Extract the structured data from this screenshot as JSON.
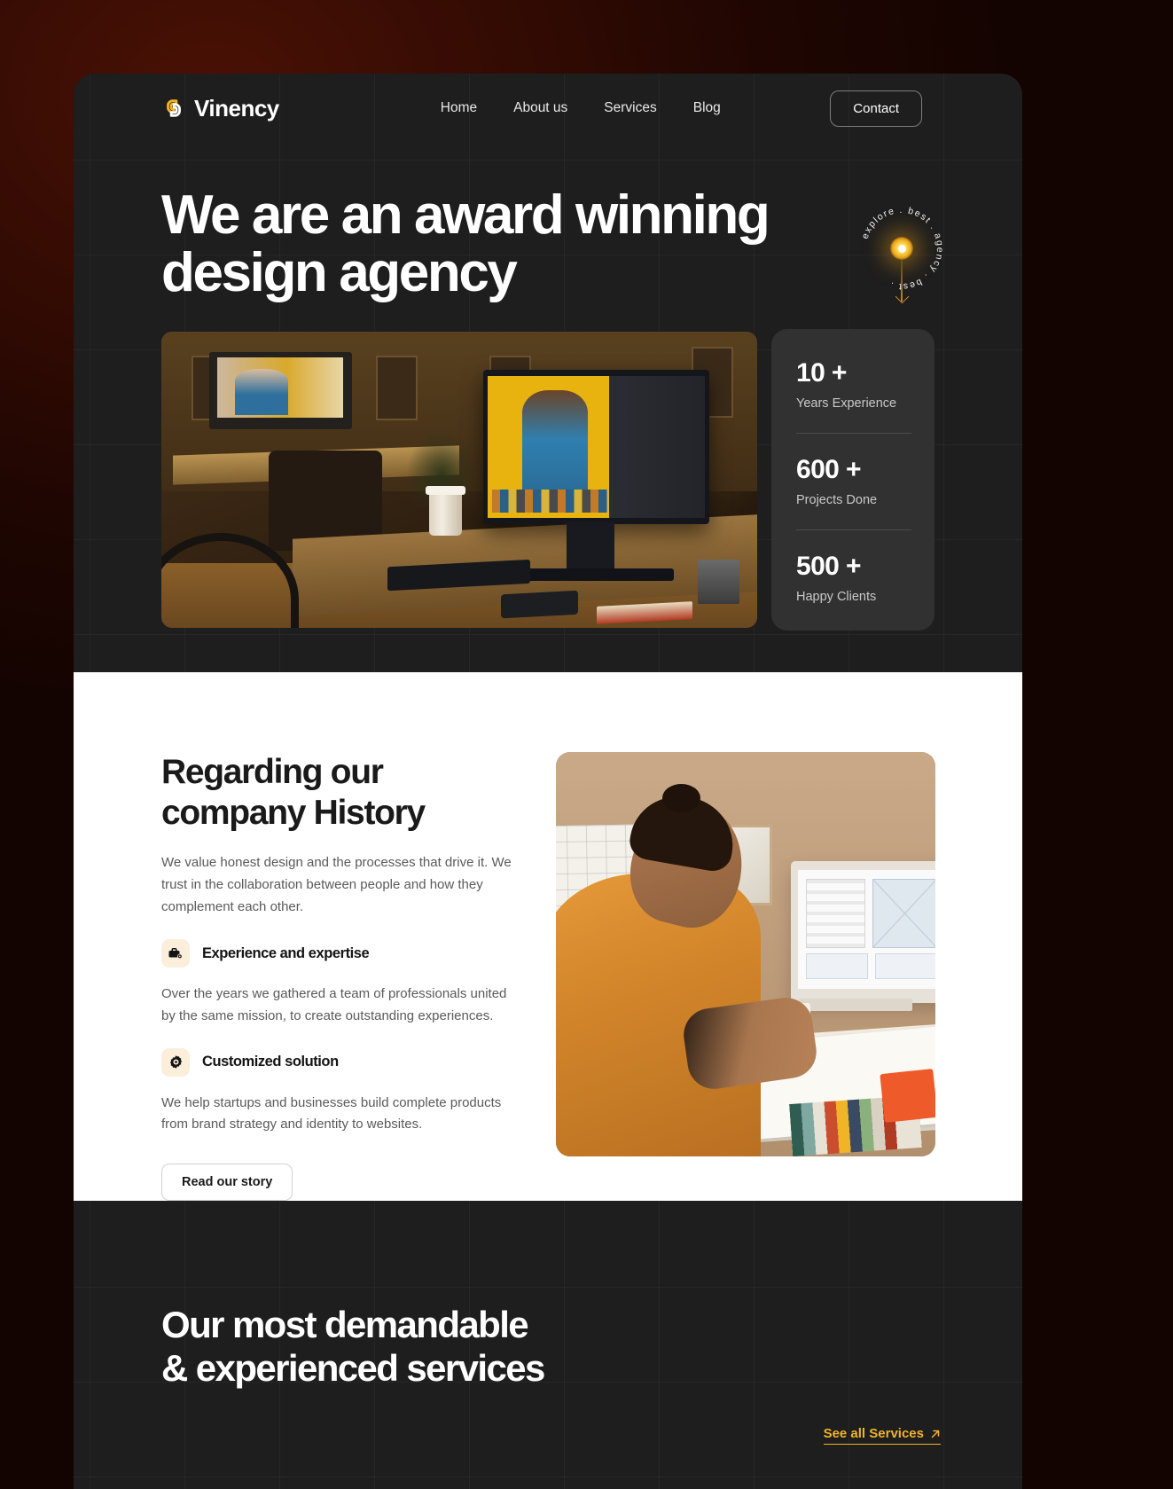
{
  "theme": {
    "accent": "#f0b429",
    "dark_card": "#1e1e1e",
    "stats_card": "#313131",
    "page_bg": "#330b03",
    "icon_tile": "#fbeedb"
  },
  "header": {
    "brand": "Vinency",
    "logo_icon": "chain-link-icon",
    "nav": [
      {
        "label": "Home"
      },
      {
        "label": "About us"
      },
      {
        "label": "Services"
      },
      {
        "label": "Blog"
      }
    ],
    "contact_label": "Contact"
  },
  "hero": {
    "heading_line1": "We are an award winning",
    "heading_line2": "design agency",
    "badge": {
      "text": "explore . best . agency . best . ",
      "center_icon": "glow-dot-icon",
      "arrow_icon": "arrow-down-icon"
    },
    "image_alt": "designer workspace with monitor running photo editing software",
    "stats": [
      {
        "value": "10 +",
        "label": "Years Experience"
      },
      {
        "value": "600 +",
        "label": "Projects Done"
      },
      {
        "value": "500 +",
        "label": "Happy Clients"
      }
    ]
  },
  "history": {
    "heading_line1": "Regarding our",
    "heading_line2": "company History",
    "intro": "We value honest design and the processes that drive   it. We trust in the collaboration between people and   how they complement each other.",
    "features": [
      {
        "icon": "briefcase-gear-icon",
        "title": "Experience and expertise",
        "body": "Over the years we gathered a team of professionals united by the same mission, to create outstanding experiences."
      },
      {
        "icon": "gear-icon",
        "title": "Customized solution",
        "body": "We help startups and businesses build complete products from brand strategy and identity to websites."
      }
    ],
    "cta_label": "Read our story",
    "image_alt": "designer sketching wireframes at a desk with color swatches"
  },
  "services": {
    "heading_line1": "Our most  demandable",
    "heading_line2": "& experienced services",
    "link_label": "See all Services",
    "link_icon": "arrow-up-right-icon"
  }
}
